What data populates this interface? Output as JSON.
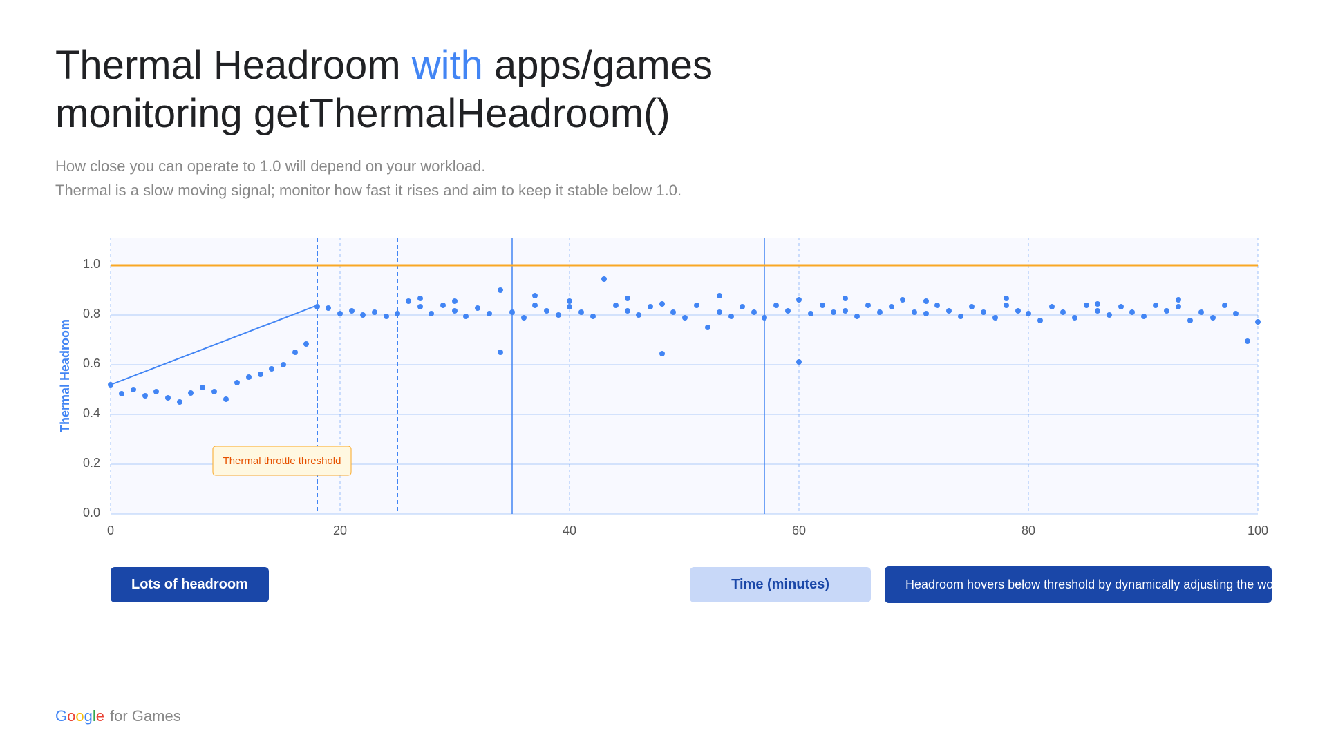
{
  "title": {
    "part1": "Thermal Headroom ",
    "highlight": "with",
    "part2": " apps/games",
    "line2": "monitoring getThermalHeadroom()"
  },
  "subtitle": {
    "line1": "How close you can operate to 1.0 will depend on your workload.",
    "line2": "Thermal is a slow moving signal; monitor how fast it rises and aim to keep it stable below 1.0."
  },
  "chart": {
    "yAxis": {
      "label": "Thermal Headroom",
      "ticks": [
        "1.0",
        "0.8",
        "0.6",
        "0.4",
        "0.2",
        "0.0"
      ]
    },
    "xAxis": {
      "label": "Time (minutes)",
      "ticks": [
        "0",
        "20",
        "40",
        "60",
        "80",
        "100"
      ]
    },
    "threshold_label": "Thermal throttle threshold",
    "threshold_value": 1.0
  },
  "badges": {
    "lots_headroom": "Lots of headroom",
    "time_minutes": "Time (minutes)",
    "description": "Headroom hovers below threshold by dynamically adjusting the workload. Device doesn't go into throttling with ADPF"
  },
  "google": {
    "letters": [
      "G",
      "o",
      "o",
      "g",
      "l",
      "e"
    ],
    "suffix": " for Games"
  }
}
